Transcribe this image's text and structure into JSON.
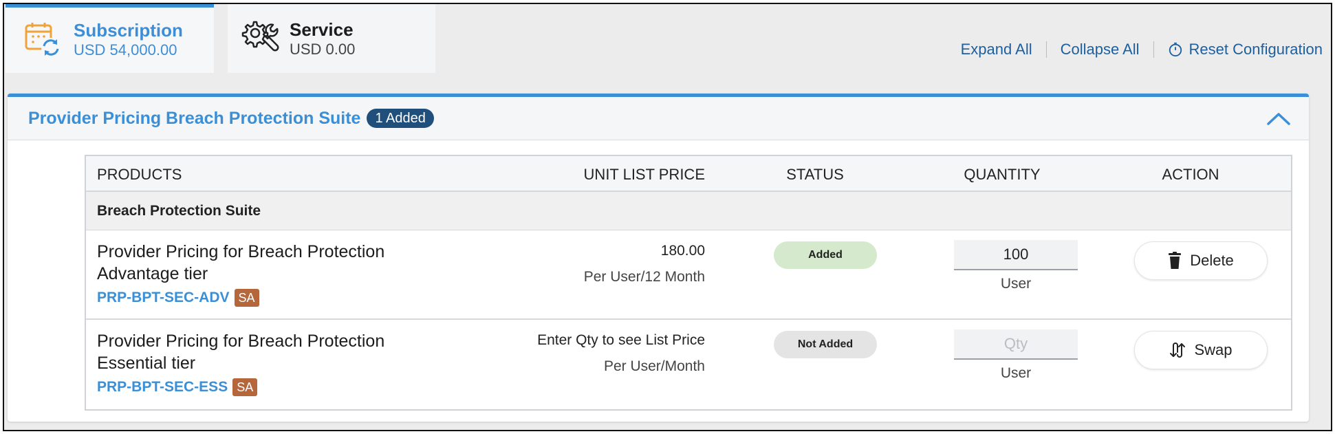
{
  "tabs": [
    {
      "title": "Subscription",
      "amount": "USD 54,000.00",
      "icon": "calendar-refresh-icon",
      "active": true
    },
    {
      "title": "Service",
      "amount": "USD 0.00",
      "icon": "gear-wrench-icon",
      "active": false
    }
  ],
  "actions": {
    "expand_all": "Expand All",
    "collapse_all": "Collapse All",
    "reset_configuration": "Reset Configuration"
  },
  "panel": {
    "title": "Provider Pricing Breach Protection Suite",
    "badge": "1 Added",
    "collapse_icon": "chevron-up-icon"
  },
  "table": {
    "headers": {
      "products": "PRODUCTS",
      "unit_list_price": "UNIT LIST PRICE",
      "status": "STATUS",
      "quantity": "QUANTITY",
      "action": "ACTION"
    },
    "group": "Breach Protection Suite",
    "rows": [
      {
        "name_line1": "Provider Pricing for Breach Protection",
        "name_line2": "Advantage tier",
        "sku": "PRP-BPT-SEC-ADV",
        "badge": "SA",
        "price": "180.00",
        "price_unit": "Per User/12 Month",
        "status": "Added",
        "quantity": "100",
        "quantity_placeholder": "",
        "quantity_unit": "User",
        "action": "Delete",
        "action_icon": "trash-icon"
      },
      {
        "name_line1": "Provider Pricing for Breach Protection",
        "name_line2": "Essential tier",
        "sku": "PRP-BPT-SEC-ESS",
        "badge": "SA",
        "price": "Enter Qty to see List Price",
        "price_unit": "Per User/Month",
        "status": "Not Added",
        "quantity": "",
        "quantity_placeholder": "Qty",
        "quantity_unit": "User",
        "action": "Swap",
        "action_icon": "swap-icon"
      }
    ]
  },
  "colors": {
    "accent": "#3a8fd6",
    "badge_dark": "#1f4f7a",
    "sa_badge": "#b5663a",
    "status_added": "#d5e9cc",
    "status_not_added": "#e4e4e5",
    "link": "#1d5f9e"
  }
}
